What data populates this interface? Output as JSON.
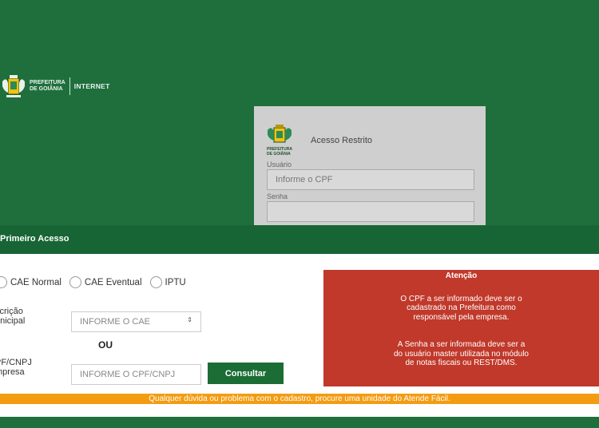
{
  "header": {
    "logo_line1": "PREFEITURA",
    "logo_line2": "DE GOIÂNIA",
    "logo_suffix": "INTERNET"
  },
  "login": {
    "pref_line1": "PREFEITURA",
    "pref_line2": "DE GOIÂNIA",
    "title": "Acesso Restrito",
    "user_label": "Usuário",
    "user_placeholder": "Informe o CPF",
    "password_label": "Senha",
    "password_placeholder": ""
  },
  "primeiro": {
    "title": "Primeiro Acesso",
    "radios": [
      "CAE Normal",
      "CAE Eventual",
      "IPTU"
    ],
    "inscricao_label_1": "scrição",
    "inscricao_label_2": "unicipal",
    "cae_placeholder": "INFORME O CAE",
    "stepper_glyph": "⇕",
    "ou": "OU",
    "cpf_label_1": "PF/CNPJ",
    "cpf_label_2": "mpresa",
    "cpf_placeholder": "INFORME O CPF/CNPJ",
    "consultar": "Consultar"
  },
  "alert": {
    "title": "Atenção",
    "p1": [
      "O CPF a ser informado deve ser o",
      "cadastrado na Prefeitura como",
      "responsável pela empresa."
    ],
    "p2": [
      "A Senha a ser informada deve ser a",
      "do usuário master utilizada no módulo",
      "de notas fiscais ou REST/DMS."
    ]
  },
  "footer_notice": "Qualquer dúvida ou problema com o cadastro, procure uma unidade do Atende Fácil.",
  "colors": {
    "green_dark": "#1f6f3d",
    "green_button": "#1b6d35",
    "alert_red": "#c0392b",
    "orange": "#f39c12"
  }
}
